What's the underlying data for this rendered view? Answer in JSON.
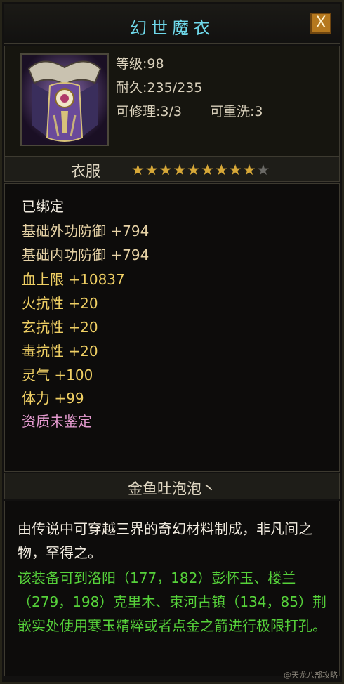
{
  "title": "幻世魔衣",
  "close_label": "X",
  "stats": {
    "level": "等级:98",
    "durability": "耐久:235/235",
    "repairable": "可修理:3/3",
    "rewash": "可重洗:3"
  },
  "item_type": "衣服",
  "stars": {
    "filled": 9,
    "total": 10,
    "filled_glyph": "★★★★★★★★★",
    "empty_glyph": "★"
  },
  "attributes": [
    {
      "text": "已绑定",
      "color": "#f2ece0"
    },
    {
      "text": "基础外功防御 +794",
      "color": "#e7d3a6"
    },
    {
      "text": "基础内功防御 +794",
      "color": "#e7d3a6"
    },
    {
      "text": "血上限 +10837",
      "color": "#f0d064"
    },
    {
      "text": "火抗性 +20",
      "color": "#f0d064"
    },
    {
      "text": "玄抗性 +20",
      "color": "#f0d064"
    },
    {
      "text": "毒抗性 +20",
      "color": "#f0d064"
    },
    {
      "text": "灵气 +100",
      "color": "#f0d064"
    },
    {
      "text": "体力 +99",
      "color": "#f0d064"
    },
    {
      "text": "资质未鉴定",
      "color": "#e59bd0"
    }
  ],
  "maker": "金鱼吐泡泡丶",
  "description": [
    {
      "text": "由传说中可穿越三界的奇幻材料制成，非凡间之物，罕得之。",
      "color": "#f2ece0"
    },
    {
      "text": "该装备可到洛阳（177，182）彭怀玉、楼兰（279，198）克里木、束河古镇（134，85）荆嵌实处使用寒玉精粹或者点金之箭进行极限打孔。",
      "color": "#56d23a"
    }
  ],
  "watermark": "@天龙八部攻略"
}
